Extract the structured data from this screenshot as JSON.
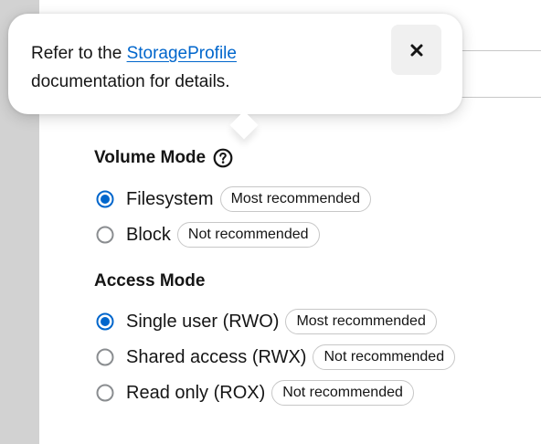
{
  "popover": {
    "text_before": "Refer to the ",
    "link": "StorageProfile",
    "text_after": " documentation for details.",
    "close_icon": "close-icon"
  },
  "volume_mode": {
    "title": "Volume Mode",
    "help_icon": "question-circle-icon",
    "options": [
      {
        "label": "Filesystem",
        "badge": "Most recommended",
        "selected": true
      },
      {
        "label": "Block",
        "badge": "Not recommended",
        "selected": false
      }
    ]
  },
  "access_mode": {
    "title": "Access Mode",
    "options": [
      {
        "label": "Single user (RWO)",
        "badge": "Most recommended",
        "selected": true
      },
      {
        "label": "Shared access (RWX)",
        "badge": "Not recommended",
        "selected": false
      },
      {
        "label": "Read only (ROX)",
        "badge": "Not recommended",
        "selected": false
      }
    ]
  },
  "colors": {
    "accent": "#0066cc",
    "text": "#151515",
    "border": "#c7c7c7",
    "side_strip": "#d2d2d2"
  }
}
